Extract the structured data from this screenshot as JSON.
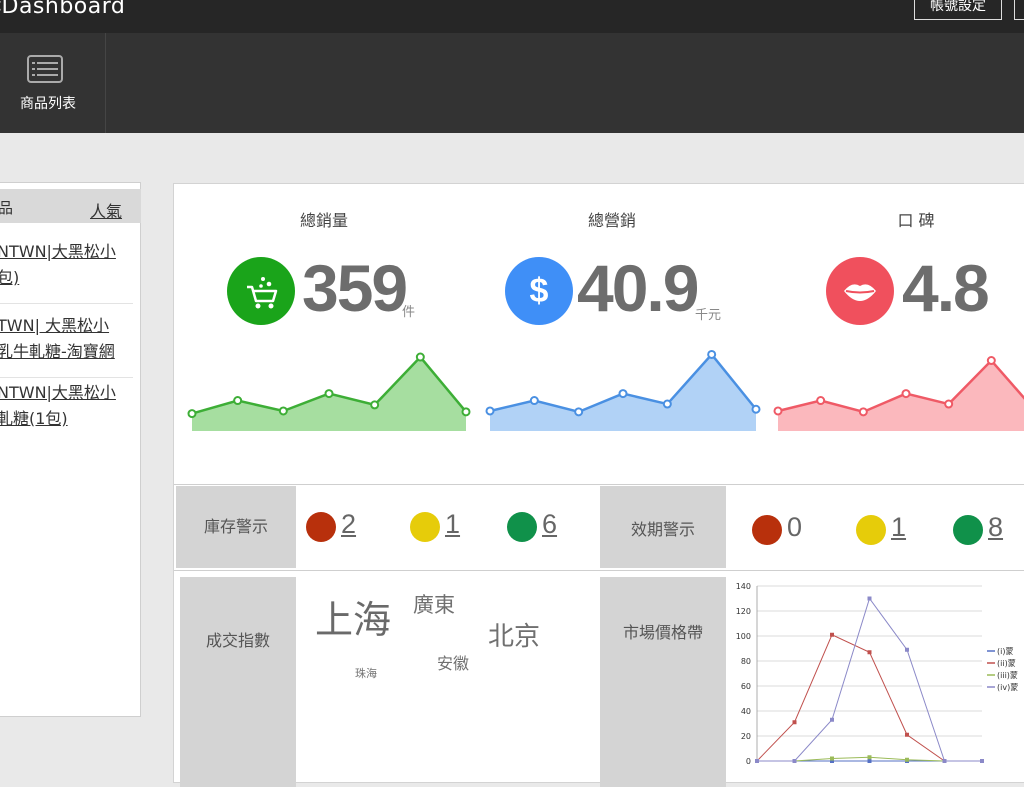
{
  "header": {
    "brand": "‡Dashboard",
    "account_label": "帳號設定"
  },
  "toolbar": {
    "items": [
      {
        "label": "商品列表",
        "icon": "list-icon"
      }
    ]
  },
  "left_panel": {
    "col_product": "品",
    "col_popular": "人氣",
    "items": [
      {
        "line1": "NTWN|大黑松小",
        "line2": "包)"
      },
      {
        "line1": "TWN| 大黑松小",
        "line2": "乳牛軋糖-淘寶網"
      },
      {
        "line1": "NTWN|大黑松小",
        "line2": "軋糖(1包)"
      }
    ]
  },
  "kpis": [
    {
      "title": "總銷量",
      "value": "359",
      "unit": "件",
      "icon": "shopping-cart-icon",
      "color": "#1aa41a",
      "spark": [
        2,
        3.5,
        2.3,
        4.3,
        3,
        8.5,
        2.2
      ],
      "fill": "#a6dea0",
      "stroke": "#3dae36"
    },
    {
      "title": "總營銷",
      "value": "40.9",
      "unit": "千元",
      "icon": "dollar-icon",
      "color": "#3f8ff7",
      "spark": [
        2.3,
        3.5,
        2.2,
        4.3,
        3.1,
        8.8,
        2.5
      ],
      "fill": "#b1d2f6",
      "stroke": "#4a90e2"
    },
    {
      "title": "口 碑",
      "value": "4.8",
      "unit": "",
      "icon": "lips-icon",
      "color": "#f0505d",
      "spark": [
        2.3,
        3.5,
        2.2,
        4.3,
        3.1,
        8.1,
        2.5
      ],
      "fill": "#fbb8bd",
      "stroke": "#ef5a66"
    }
  ],
  "alerts": {
    "stock_label": "庫存警示",
    "stock": [
      {
        "color": "#b8300c",
        "count": "2"
      },
      {
        "color": "#e6cc0a",
        "count": "1"
      },
      {
        "color": "#10914a",
        "count": "6"
      }
    ],
    "expiry_label": "效期警示",
    "expiry": [
      {
        "color": "#b8300c",
        "count": "0"
      },
      {
        "color": "#e6cc0a",
        "count": "1"
      },
      {
        "color": "#10914a",
        "count": "8"
      }
    ]
  },
  "deals": {
    "label": "成交指數",
    "words": [
      "上海",
      "廣東",
      "北京",
      "安徽",
      "珠海"
    ]
  },
  "market": {
    "label": "市場價格帶"
  },
  "chart_data": {
    "type": "line",
    "x": [
      1,
      2,
      3,
      4,
      5,
      6,
      7
    ],
    "ylim": [
      0,
      140
    ],
    "yticks": [
      0,
      20,
      40,
      60,
      80,
      100,
      120,
      140
    ],
    "series": [
      {
        "name": "(i)蒙",
        "color": "#5571c4",
        "values": [
          0,
          0,
          0,
          0,
          0,
          0,
          0
        ]
      },
      {
        "name": "(ii)蒙",
        "color": "#c0504d",
        "values": [
          0,
          31,
          101,
          87,
          21,
          0,
          0
        ]
      },
      {
        "name": "(iii)蒙",
        "color": "#9bbb59",
        "values": [
          0,
          0,
          2,
          3,
          1,
          0,
          0
        ]
      },
      {
        "name": "(iv)蒙",
        "color": "#8b89c8",
        "values": [
          0,
          0,
          33,
          130,
          89,
          0,
          0
        ]
      }
    ],
    "legend": [
      "(i)蒙",
      "(ii)蒙",
      "(iii)蒙",
      "(iv)蒙"
    ]
  }
}
